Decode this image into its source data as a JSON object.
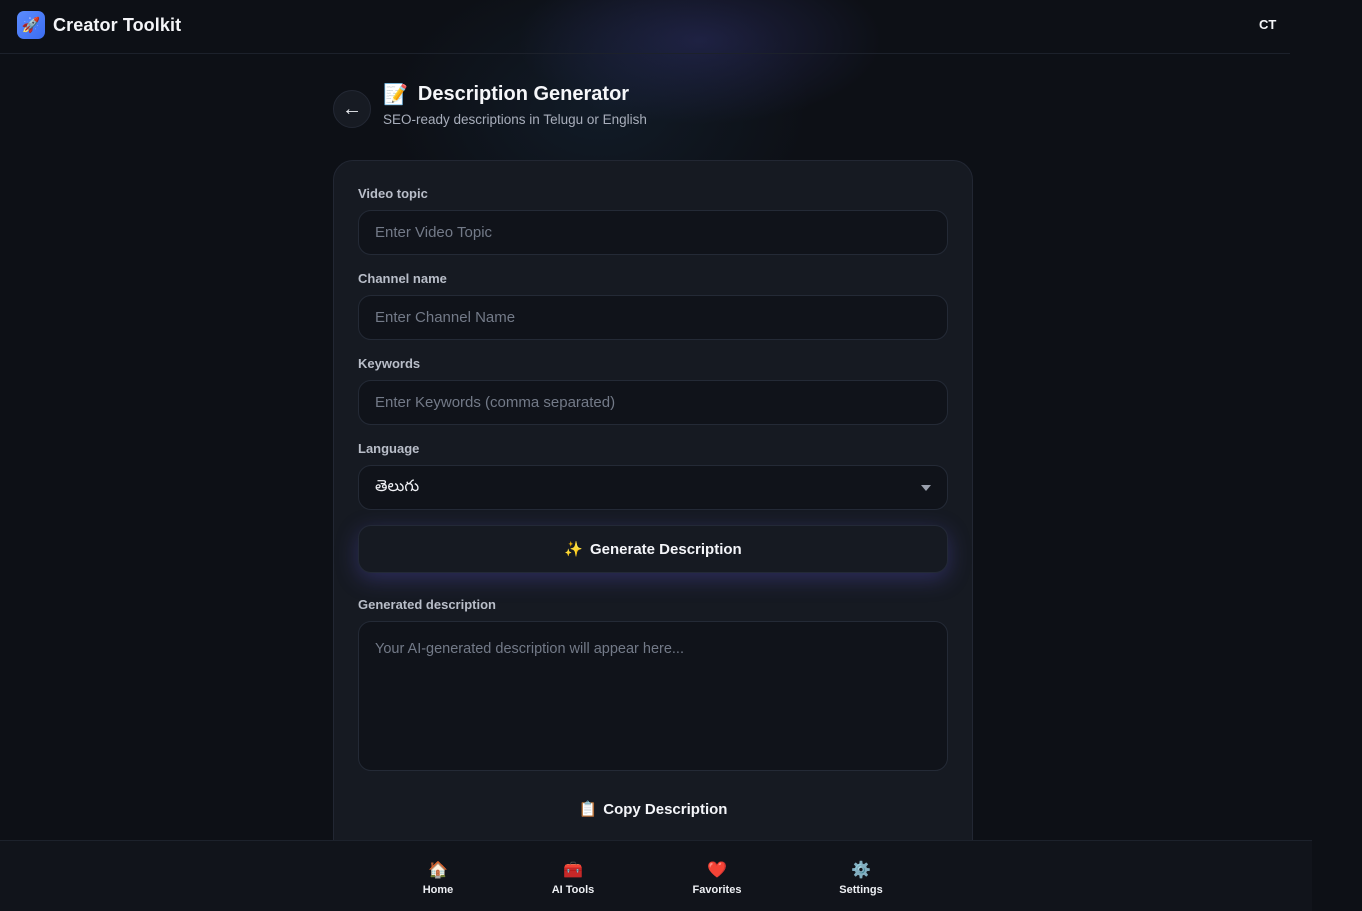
{
  "header": {
    "brand_icon": "rocket-icon",
    "brand_glyph": "🚀",
    "brand_name": "Creator Toolkit",
    "avatar_initials": "CT"
  },
  "page": {
    "back_glyph": "←",
    "title_icon": "📝",
    "title": "Description Generator",
    "subtitle": "SEO-ready descriptions in Telugu or English"
  },
  "form": {
    "video_topic": {
      "label": "Video topic",
      "value": "",
      "placeholder": "Enter Video Topic"
    },
    "channel_name": {
      "label": "Channel name",
      "value": "",
      "placeholder": "Enter Channel Name"
    },
    "keywords": {
      "label": "Keywords",
      "value": "",
      "placeholder": "Enter Keywords (comma separated)"
    },
    "language": {
      "label": "Language",
      "selected": "తెలుగు"
    },
    "generate_button": {
      "icon": "✨",
      "label": "Generate Description"
    },
    "output": {
      "label": "Generated description",
      "value": "",
      "placeholder": "Your AI-generated description will appear here..."
    },
    "copy_button": {
      "icon": "📋",
      "label": "Copy Description"
    }
  },
  "nav": {
    "items": [
      {
        "icon_name": "house-icon",
        "glyph": "🏠",
        "label": "Home"
      },
      {
        "icon_name": "toolbox-icon",
        "glyph": "🧰",
        "label": "AI Tools"
      },
      {
        "icon_name": "heart-icon",
        "glyph": "❤️",
        "label": "Favorites"
      },
      {
        "icon_name": "gear-icon",
        "glyph": "⚙️",
        "label": "Settings"
      }
    ]
  },
  "colors": {
    "background": "#0d1016",
    "card": "#161a22",
    "input": "#10131a",
    "accent_glow": "#5a50c8",
    "brand_logo": "#4a7cf5"
  }
}
